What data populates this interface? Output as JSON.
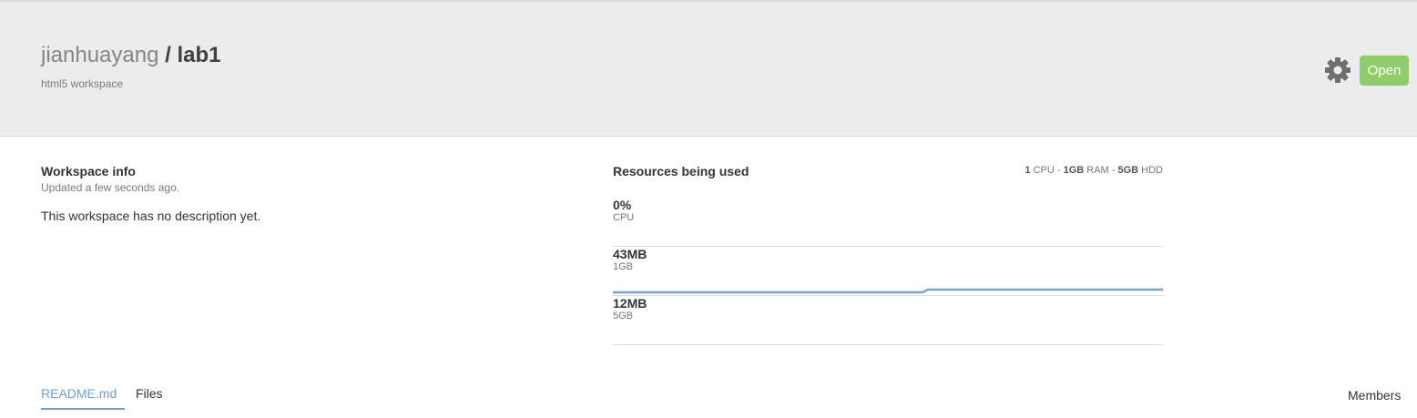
{
  "header": {
    "owner": "jianhuayang",
    "separator": " / ",
    "workspace": "lab1",
    "subtitle": "html5 workspace",
    "open_label": "Open"
  },
  "workspace_info": {
    "title": "Workspace info",
    "updated": "Updated a few seconds ago.",
    "description": "This workspace has no description yet."
  },
  "resources": {
    "title": "Resources being used",
    "limits": {
      "cpu_count": "1",
      "cpu_unit": " CPU - ",
      "ram_amount": "1GB",
      "ram_unit": " RAM - ",
      "hdd_amount": "5GB",
      "hdd_unit": " HDD"
    },
    "metrics": [
      {
        "value": "0%",
        "label": "CPU",
        "usage_fraction": 0
      },
      {
        "value": "43MB",
        "label": "1GB",
        "usage_fraction": 0.042
      },
      {
        "value": "12MB",
        "label": "5GB",
        "usage_fraction": 0.0024
      }
    ]
  },
  "tabs": {
    "readme": "README.md",
    "files": "Files",
    "members": "Members"
  },
  "colors": {
    "accent": "#6fa0cf",
    "open_button": "#8fcc6a",
    "graph_line": "#7aa3cc"
  },
  "icons": {
    "settings": "gear-icon"
  }
}
